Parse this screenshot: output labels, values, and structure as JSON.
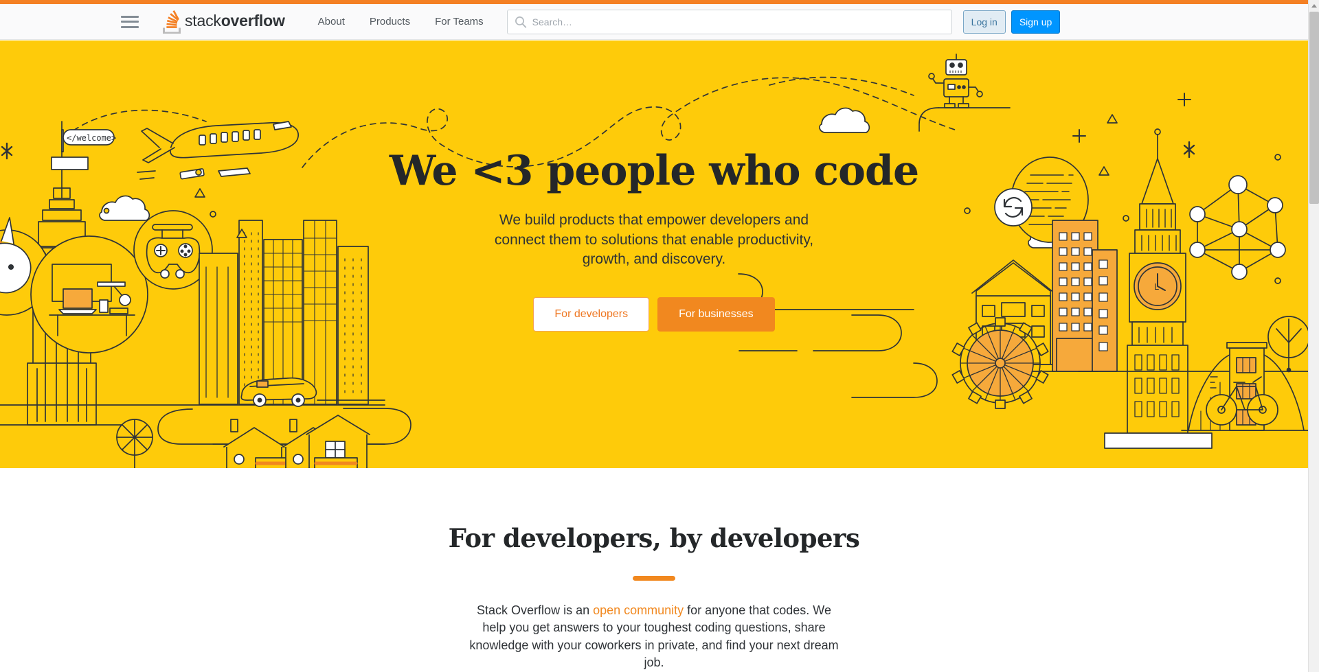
{
  "theme": {
    "accent_orange": "#f48024",
    "hero_yellow": "#fecb0a",
    "cta_orange": "#f1881f",
    "signup_blue": "#0095ff",
    "login_blue_bg": "#e1ecf4",
    "text_dark": "#242729",
    "nav_grey": "#535a60"
  },
  "header": {
    "menu_icon": "hamburger-menu-icon",
    "logo": {
      "icon": "stack-overflow-logo-icon",
      "text_light": "stack",
      "text_bold": "overflow"
    },
    "nav": [
      {
        "label": "About"
      },
      {
        "label": "Products"
      },
      {
        "label": "For Teams"
      }
    ],
    "search": {
      "icon": "search-icon",
      "placeholder": "Search…",
      "value": ""
    },
    "auth": {
      "login_label": "Log in",
      "signup_label": "Sign up"
    }
  },
  "hero": {
    "title": "We <3 people who code",
    "subtitle": "We build products that empower developers and connect them to solutions that enable productivity, growth, and discovery.",
    "cta_developers": "For developers",
    "cta_businesses": "For businesses",
    "illustration": {
      "flag_label": "</welcome>",
      "clock_label": "L",
      "elements": [
        "empire-state-building",
        "welcome-flag",
        "unicorn-icon",
        "airplane-icon",
        "dashed-flight-path",
        "cloud-icon",
        "desk-laptop-circle-icon",
        "game-controller-circle-icon",
        "city-skyline",
        "car-icon",
        "houses",
        "tree-icon",
        "ferris-wheel-icon",
        "big-ben-clock-tower",
        "robot-icon",
        "code-document-sync-icon",
        "network-graph-icon",
        "tower-bridge-icon",
        "bicycle-icon",
        "sparkle-icon",
        "plus-icon",
        "triangle-icon",
        "circle-dot-icon"
      ]
    }
  },
  "developers_section": {
    "title": "For developers, by developers",
    "body_before_link": "Stack Overflow is an ",
    "link_text": "open community",
    "body_after_link": " for anyone that codes. We help you get answers to your toughest coding questions, share knowledge with your coworkers in private, and find your next dream job."
  },
  "scrollbar": {
    "up_arrow_icon": "scroll-up-arrow-icon",
    "thumb": "scrollbar-thumb"
  }
}
